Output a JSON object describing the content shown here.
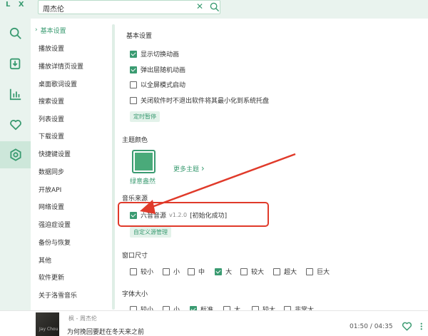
{
  "app": {
    "logo": "L X"
  },
  "search": {
    "value": "周杰伦"
  },
  "sidebar": {
    "items": [
      {
        "name": "search",
        "icon": "search-icon"
      },
      {
        "name": "download",
        "icon": "download-icon"
      },
      {
        "name": "leaderboard",
        "icon": "leaderboard-icon"
      },
      {
        "name": "favorite",
        "icon": "heart-icon"
      },
      {
        "name": "settings",
        "icon": "settings-icon",
        "active": true
      }
    ]
  },
  "subnav": {
    "items": [
      {
        "label": "基本设置",
        "active": true
      },
      {
        "label": "播放设置"
      },
      {
        "label": "播放详情页设置"
      },
      {
        "label": "桌面歌词设置"
      },
      {
        "label": "搜索设置"
      },
      {
        "label": "列表设置"
      },
      {
        "label": "下载设置"
      },
      {
        "label": "快捷键设置"
      },
      {
        "label": "数据同步"
      },
      {
        "label": "开放API"
      },
      {
        "label": "网络设置"
      },
      {
        "label": "强迫症设置"
      },
      {
        "label": "备份与恢复"
      },
      {
        "label": "其他"
      },
      {
        "label": "软件更新"
      },
      {
        "label": "关于洛雪音乐"
      }
    ]
  },
  "basic": {
    "title": "基本设置",
    "options": [
      {
        "label": "显示切换动画",
        "checked": true
      },
      {
        "label": "弹出层随机动画",
        "checked": true
      },
      {
        "label": "以全屏模式启动",
        "checked": false
      },
      {
        "label": "关闭软件时不退出软件将其最小化到系统托盘",
        "checked": false
      }
    ],
    "timer_button": "定时暂停"
  },
  "theme": {
    "title": "主题颜色",
    "name": "绿意盎然",
    "more": "更多主题",
    "color": "#4aaa7a"
  },
  "source": {
    "title": "音乐来源",
    "name": "六音音源",
    "version": "v1.2.0",
    "status": "[初始化成功]",
    "checked": true,
    "manage_button": "自定义源管理"
  },
  "window_size": {
    "title": "窗口尺寸",
    "options": [
      {
        "label": "较小",
        "checked": false
      },
      {
        "label": "小",
        "checked": false
      },
      {
        "label": "中",
        "checked": false
      },
      {
        "label": "大",
        "checked": true
      },
      {
        "label": "较大",
        "checked": false
      },
      {
        "label": "超大",
        "checked": false
      },
      {
        "label": "巨大",
        "checked": false
      }
    ]
  },
  "font_size": {
    "title": "字体大小",
    "options": [
      {
        "label": "较小",
        "checked": false
      },
      {
        "label": "小",
        "checked": false
      },
      {
        "label": "标准",
        "checked": true
      },
      {
        "label": "大",
        "checked": false
      },
      {
        "label": "较大",
        "checked": false
      },
      {
        "label": "非常大",
        "checked": false
      }
    ]
  },
  "player": {
    "track": "枫 - 周杰伦",
    "lyric": "为何挽回要赶在冬天来之前",
    "album_text": "Jay Chou",
    "time": "01:50 / 04:35"
  },
  "colors": {
    "accent": "#3a9b71",
    "annotation": "#e03a2a"
  }
}
